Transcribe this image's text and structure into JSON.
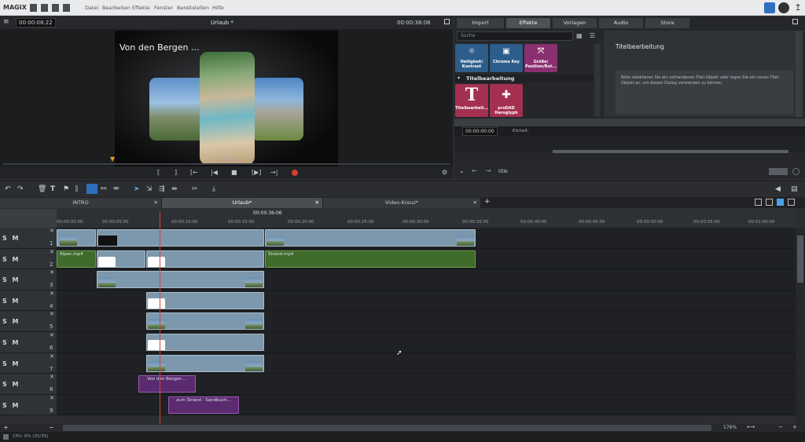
{
  "menubar": {
    "logo": "MAGIX",
    "items": [
      "Datei",
      "Bearbeiten",
      "Effekte",
      "Fenster",
      "Bereitstellen",
      "Hilfe"
    ]
  },
  "preview": {
    "timecode_left": "00:00:08:22",
    "title": "Urlaub *",
    "timecode_right": "00:00:36:06",
    "overlay_text": "Von den Bergen ...",
    "scrub_time": "36:06"
  },
  "right_panel": {
    "tabs": [
      "Import",
      "Effekte",
      "Vorlagen",
      "Audio",
      "Store"
    ],
    "active_tab": "Effekte",
    "search_placeholder": "Suche",
    "tiles_row1": [
      "Helligkeit/ Kontrast",
      "Chroma Key",
      "Größe/ Position/Rot..."
    ],
    "section_title": "Titelbearbeitung",
    "tiles_row2": [
      "Titelbearbeit...",
      "proDAD Heroglyph"
    ],
    "info_title": "Titelbearbeitung",
    "info_text": "Bitte selektieren Sie ein vorhandenes Titel-Objekt oder legen Sie ein neues Titel-Objekt an, um diesen Dialog verwenden zu können.",
    "kf_time": "00:00:00:00",
    "kf_label": "Einheit:",
    "bottom_label": "title"
  },
  "project_tabs": [
    "INTRO",
    "Urlaub*",
    "Video-Kreuz*"
  ],
  "ruler": {
    "current": "00:00:36:06",
    "labels": [
      "00:00:00:00",
      "00:00:05:00",
      "00:00:10:00",
      "00:00:15:00",
      "00:00:20:00",
      "00:00:25:00",
      "00:00:30:00",
      "00:00:35:00",
      "00:00:40:00",
      "00:00:45:00",
      "00:00:50:00",
      "00:00:55:00",
      "00:01:00:00",
      "00:01:05:00"
    ]
  },
  "tracks": [
    "1",
    "2",
    "3",
    "4",
    "5",
    "6",
    "7",
    "8",
    "9"
  ],
  "track_controls": "S M",
  "clips": {
    "t2_a": "Alpen.mp4",
    "t2_b": "Strand.mp4",
    "t8": "Von den Bergen ...",
    "t9": "zum Strand - Sandbuch..."
  },
  "zoom": "176%",
  "status": "CPU: 9% (35/35)"
}
